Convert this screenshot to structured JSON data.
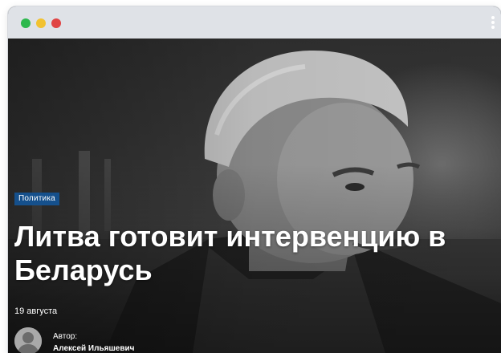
{
  "window": {
    "controls": {
      "close_color": "#2db84d",
      "minimize_color": "#f2c230",
      "maximize_color": "#e04444"
    },
    "menu_icon": "kebab-menu-icon"
  },
  "article": {
    "category": "Политика",
    "title": "Литва готовит интервенцию в Беларусь",
    "date": "19 августа",
    "author_label": "Автор:",
    "author_name": "Алексей Ильяшевич",
    "accent_color": "#15508c"
  }
}
